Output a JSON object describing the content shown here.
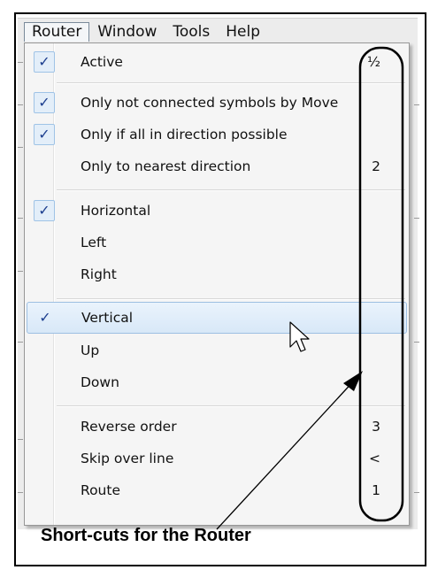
{
  "menubar": {
    "items": [
      "Router",
      "Window",
      "Tools",
      "Help"
    ]
  },
  "router_menu": {
    "items": [
      {
        "label": "Active",
        "checked": true,
        "shortcut": "½"
      },
      {
        "label": "Only not connected symbols by Move",
        "checked": true,
        "shortcut": ""
      },
      {
        "label": "Only if all in direction possible",
        "checked": true,
        "shortcut": ""
      },
      {
        "label": "Only to nearest direction",
        "checked": false,
        "shortcut": "2"
      },
      {
        "label": "Horizontal",
        "checked": true,
        "shortcut": ""
      },
      {
        "label": "Left",
        "checked": false,
        "shortcut": ""
      },
      {
        "label": "Right",
        "checked": false,
        "shortcut": ""
      },
      {
        "label": "Vertical",
        "checked": true,
        "shortcut": "",
        "highlighted": true
      },
      {
        "label": "Up",
        "checked": false,
        "shortcut": ""
      },
      {
        "label": "Down",
        "checked": false,
        "shortcut": ""
      },
      {
        "label": "Reverse order",
        "checked": false,
        "shortcut": "3"
      },
      {
        "label": "Skip over line",
        "checked": false,
        "shortcut": "<"
      },
      {
        "label": "Route",
        "checked": false,
        "shortcut": "1"
      }
    ],
    "check_glyph": "✓"
  },
  "annotation": {
    "text": "Short-cuts for the Router"
  },
  "colors": {
    "highlight": "#d8e8f8",
    "check": "#1d3f8f"
  }
}
